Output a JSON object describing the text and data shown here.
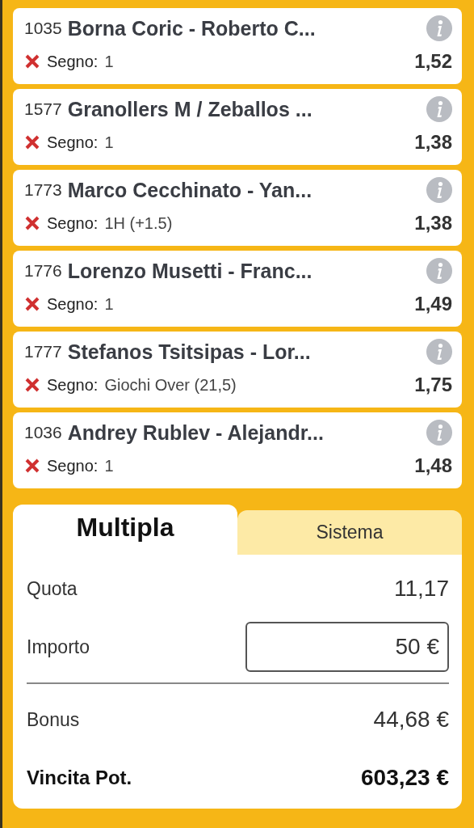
{
  "selections": [
    {
      "code": "1035",
      "match": "Borna Coric - Roberto C...",
      "label": "Segno:",
      "pick": "1",
      "odds": "1,52",
      "lost": true
    },
    {
      "code": "1577",
      "match": "Granollers M / Zeballos ...",
      "label": "Segno:",
      "pick": "1",
      "odds": "1,38",
      "lost": true
    },
    {
      "code": "1773",
      "match": "Marco Cecchinato - Yan...",
      "label": "Segno:",
      "pick": "1H (+1.5)",
      "odds": "1,38",
      "lost": true
    },
    {
      "code": "1776",
      "match": "Lorenzo Musetti - Franc...",
      "label": "Segno:",
      "pick": "1",
      "odds": "1,49",
      "lost": true
    },
    {
      "code": "1777",
      "match": "Stefanos Tsitsipas - Lor...",
      "label": "Segno:",
      "pick": "Giochi Over (21,5)",
      "odds": "1,75",
      "lost": true
    },
    {
      "code": "1036",
      "match": "Andrey Rublev - Alejandr...",
      "label": "Segno:",
      "pick": "1",
      "odds": "1,48",
      "lost": true
    }
  ],
  "tabs": [
    {
      "label": "Multipla",
      "selected": true
    },
    {
      "label": "Sistema",
      "selected": false
    }
  ],
  "summary": [
    {
      "kind": "value",
      "label": "Quota",
      "value": "11,17"
    },
    {
      "kind": "input",
      "label": "Importo",
      "value": "50 €"
    },
    {
      "kind": "divider"
    },
    {
      "kind": "value",
      "label": "Bonus",
      "value": "44,68 €"
    },
    {
      "kind": "total",
      "label": "Vincita Pot.",
      "value": "603,23 €"
    }
  ]
}
